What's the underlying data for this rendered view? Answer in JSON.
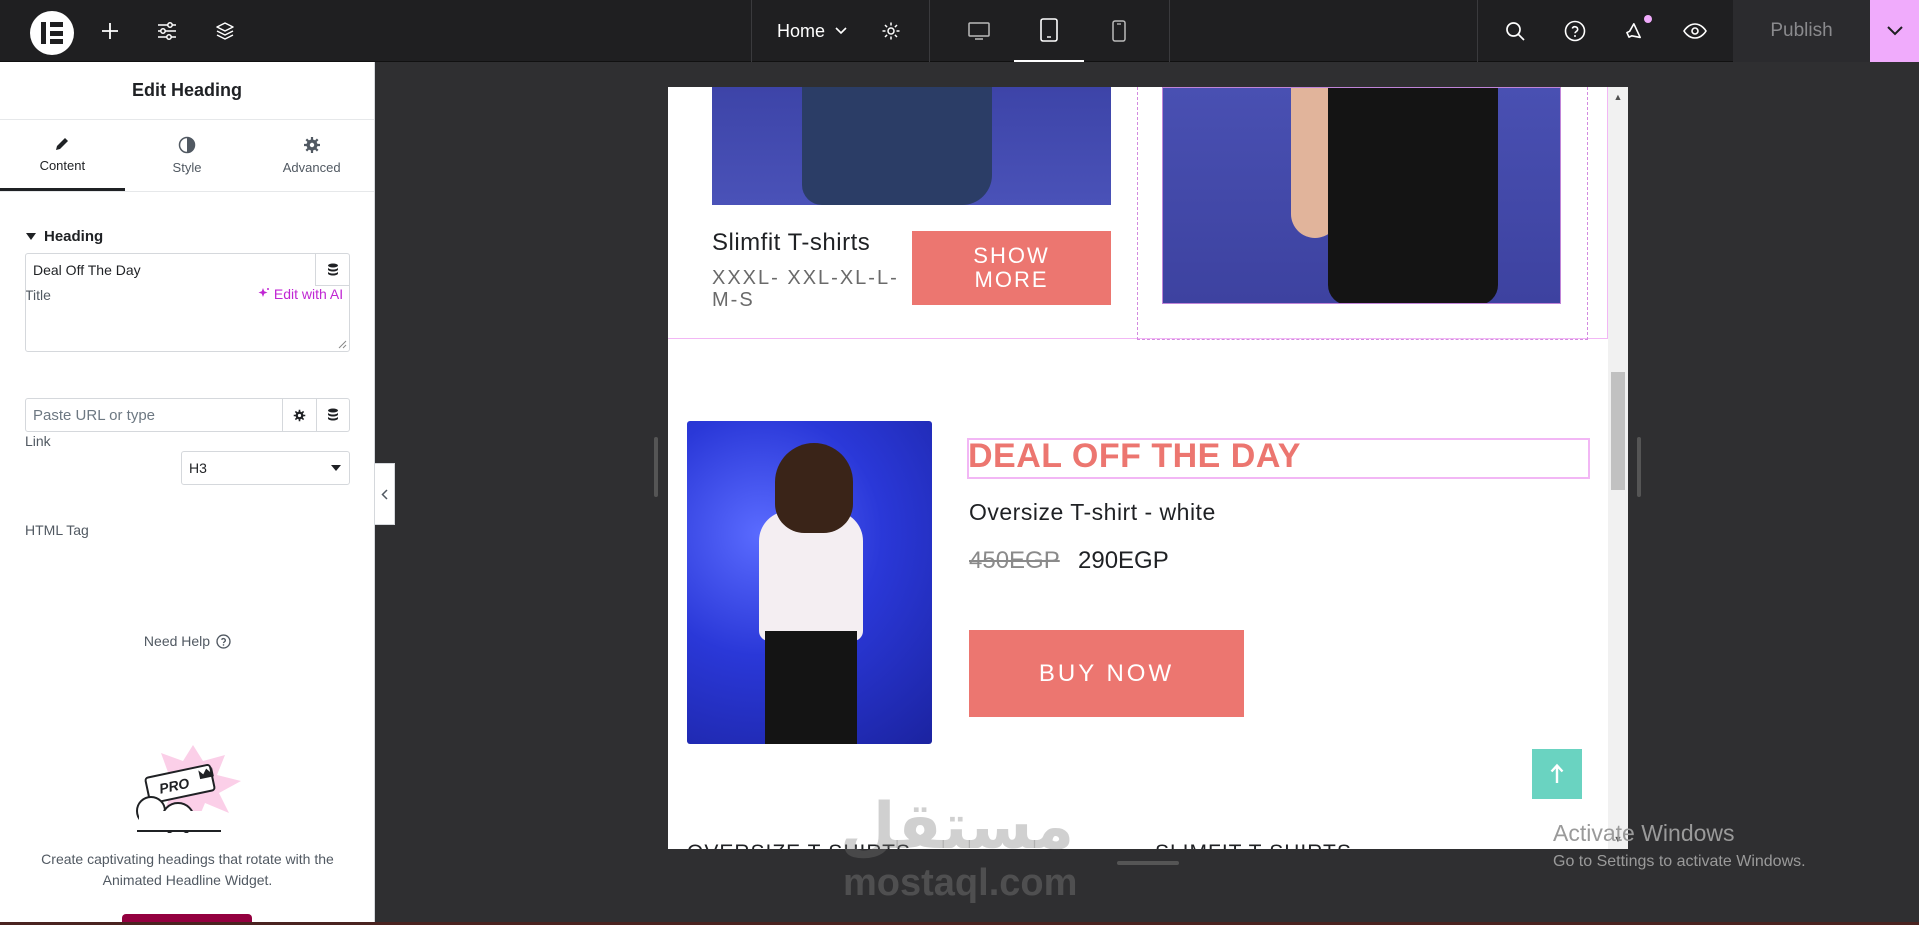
{
  "topbar": {
    "page_name": "Home",
    "publish_label": "Publish"
  },
  "panel": {
    "title": "Edit Heading",
    "tabs": [
      {
        "label": "Content",
        "icon": "pencil-icon"
      },
      {
        "label": "Style",
        "icon": "half-circle-icon"
      },
      {
        "label": "Advanced",
        "icon": "gear-icon"
      }
    ],
    "section_title": "Heading",
    "title_label": "Title",
    "edit_ai_label": "Edit with AI",
    "title_value": "Deal Off The Day",
    "link_label": "Link",
    "link_placeholder": "Paste URL or type",
    "html_tag_label": "HTML Tag",
    "html_tag_value": "H3",
    "need_help": "Need Help",
    "promo_badge": "PRO",
    "promo_text": "Create captivating headings that rotate with the Animated Headline Widget."
  },
  "canvas": {
    "product1_name": "Slimfit T-shirts",
    "product1_sizes": "XXXL- XXL-XL-L-M-S",
    "show_more": "SHOW MORE",
    "deal_heading": "DEAL OFF THE DAY",
    "deal_product": "Oversize T-shirt - white",
    "old_price": "450EGP",
    "new_price": "290EGP",
    "buy_now": "BUY NOW",
    "bottom_cat_1": "OVERSIZE T-SHIRTS",
    "bottom_cat_2": "SLIMFIT T-SHIRTS"
  },
  "overlays": {
    "watermark_ar": "مستقل",
    "watermark_en": "mostaql.com",
    "activate_title": "Activate Windows",
    "activate_sub": "Go to Settings to activate Windows."
  },
  "colors": {
    "accent_pink": "#f0abfc",
    "button_coral": "#ec7670",
    "back_to_top": "#6ad3c1",
    "ai_magenta": "#c026d3"
  }
}
